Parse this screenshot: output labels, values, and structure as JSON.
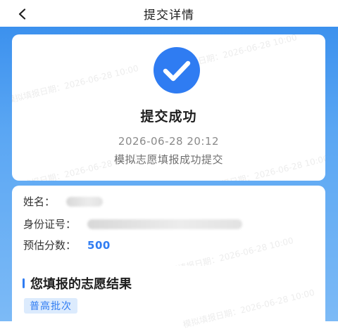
{
  "header": {
    "title": "提交详情",
    "back_icon": "chevron-left-icon"
  },
  "success_card": {
    "icon": "check-circle-icon",
    "icon_color": "#2f7cf2",
    "title": "提交成功",
    "time": "2026-06-28 20:12",
    "message": "模拟志愿填报成功提交"
  },
  "info": {
    "name_label": "姓名：",
    "id_label": "身份证号：",
    "score_label": "预估分数：",
    "score_value": "500"
  },
  "result": {
    "title": "您填报的志愿结果",
    "batch_tag": "普高批次"
  },
  "watermark": {
    "text": "模拟填报日期：2026-06-28 10:00"
  },
  "colors": {
    "accent": "#2f7cf2",
    "background_gradient_top": "#3c91ee",
    "background_gradient_bottom": "#7cbaf6"
  }
}
